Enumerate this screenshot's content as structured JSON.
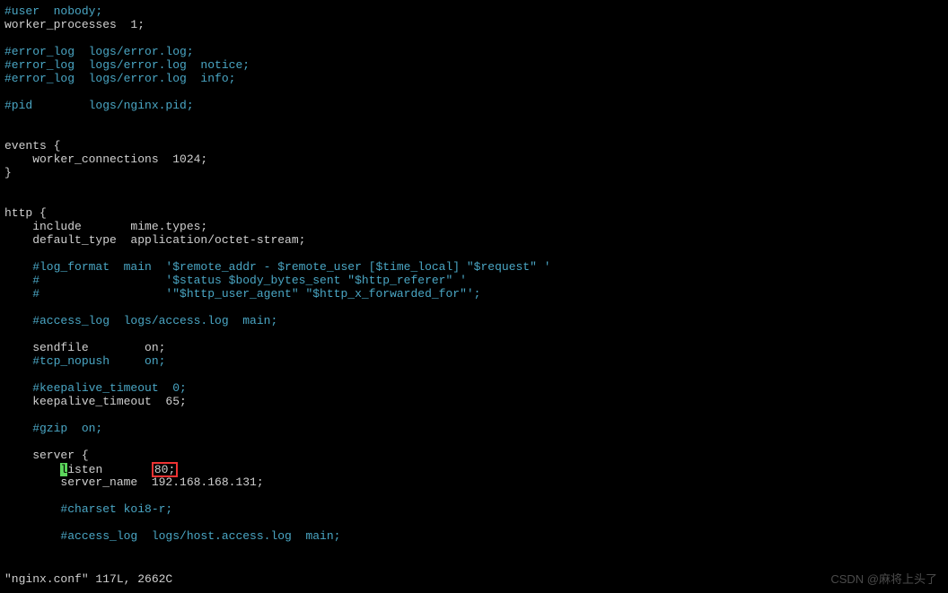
{
  "lines": [
    {
      "t": "comment",
      "text": "#user  nobody;"
    },
    {
      "t": "normal",
      "text": "worker_processes  1;"
    },
    {
      "t": "blank",
      "text": ""
    },
    {
      "t": "comment",
      "text": "#error_log  logs/error.log;"
    },
    {
      "t": "comment",
      "text": "#error_log  logs/error.log  notice;"
    },
    {
      "t": "comment",
      "text": "#error_log  logs/error.log  info;"
    },
    {
      "t": "blank",
      "text": ""
    },
    {
      "t": "comment",
      "text": "#pid        logs/nginx.pid;"
    },
    {
      "t": "blank",
      "text": ""
    },
    {
      "t": "blank",
      "text": ""
    },
    {
      "t": "normal",
      "text": "events {"
    },
    {
      "t": "normal",
      "text": "    worker_connections  1024;"
    },
    {
      "t": "normal",
      "text": "}"
    },
    {
      "t": "blank",
      "text": ""
    },
    {
      "t": "blank",
      "text": ""
    },
    {
      "t": "normal",
      "text": "http {"
    },
    {
      "t": "normal",
      "text": "    include       mime.types;"
    },
    {
      "t": "normal",
      "text": "    default_type  application/octet-stream;"
    },
    {
      "t": "blank",
      "text": ""
    },
    {
      "t": "comment",
      "text": "    #log_format  main  '$remote_addr - $remote_user [$time_local] \"$request\" '"
    },
    {
      "t": "comment",
      "text": "    #                  '$status $body_bytes_sent \"$http_referer\" '"
    },
    {
      "t": "comment",
      "text": "    #                  '\"$http_user_agent\" \"$http_x_forwarded_for\"';"
    },
    {
      "t": "blank",
      "text": ""
    },
    {
      "t": "comment",
      "text": "    #access_log  logs/access.log  main;"
    },
    {
      "t": "blank",
      "text": ""
    },
    {
      "t": "normal",
      "text": "    sendfile        on;"
    },
    {
      "t": "comment",
      "text": "    #tcp_nopush     on;"
    },
    {
      "t": "blank",
      "text": ""
    },
    {
      "t": "comment",
      "text": "    #keepalive_timeout  0;"
    },
    {
      "t": "normal",
      "text": "    keepalive_timeout  65;"
    },
    {
      "t": "blank",
      "text": ""
    },
    {
      "t": "comment",
      "text": "    #gzip  on;"
    },
    {
      "t": "blank",
      "text": ""
    },
    {
      "t": "normal",
      "text": "    server {"
    }
  ],
  "listen_line": {
    "prefix": "        ",
    "cursor_char": "l",
    "after_cursor": "isten       ",
    "boxed": "80;"
  },
  "lines_after": [
    {
      "t": "normal",
      "text": "        server_name  192.168.168.131;"
    },
    {
      "t": "blank",
      "text": ""
    },
    {
      "t": "comment",
      "text": "        #charset koi8-r;"
    },
    {
      "t": "blank",
      "text": ""
    },
    {
      "t": "comment",
      "text": "        #access_log  logs/host.access.log  main;"
    }
  ],
  "status": "\"nginx.conf\" 117L, 2662C",
  "watermark": "CSDN @麻将上头了"
}
